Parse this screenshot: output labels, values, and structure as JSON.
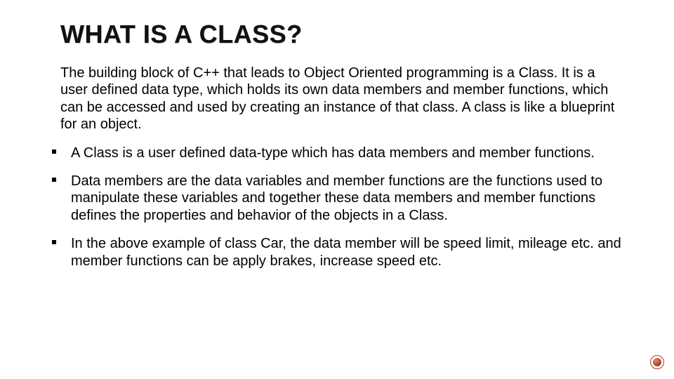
{
  "slide": {
    "title": "WHAT IS A CLASS?",
    "intro": "The building block of C++ that leads to Object Oriented programming is a Class. It is a user defined data type, which holds its own data members and member functions, which can be accessed and used by creating an instance of that class. A class is like a blueprint for an object.",
    "bullets": [
      "A Class is a user defined data-type which has data members and member functions.",
      "Data members are the data variables and member functions are the functions used to manipulate these variables and together these data members and member functions defines the properties and behavior of the objects in a Class.",
      "In the above example of class Car, the data member will be speed limit, mileage etc. and member functions can be apply brakes, increase speed etc."
    ]
  },
  "decor": {
    "corner_icon": "circle-dot-icon"
  }
}
